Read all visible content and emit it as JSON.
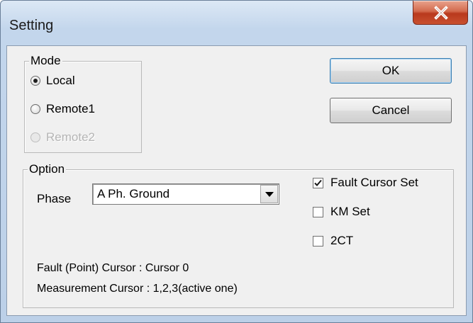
{
  "window": {
    "title": "Setting",
    "close_glyph": "X"
  },
  "mode": {
    "label": "Mode",
    "options": [
      {
        "label": "Local",
        "checked": true,
        "disabled": false
      },
      {
        "label": "Remote1",
        "checked": false,
        "disabled": false
      },
      {
        "label": "Remote2",
        "checked": false,
        "disabled": true
      }
    ]
  },
  "buttons": {
    "ok": "OK",
    "cancel": "Cancel"
  },
  "option": {
    "label": "Option",
    "phase_label": "Phase",
    "phase_value": "A Ph. Ground",
    "checkboxes": [
      {
        "label": "Fault Cursor Set",
        "checked": true
      },
      {
        "label": "KM Set",
        "checked": false
      },
      {
        "label": "2CT",
        "checked": false
      }
    ],
    "info_lines": [
      "Fault (Point) Cursor : Cursor 0",
      "Measurement Cursor : 1,2,3(active one)"
    ]
  },
  "colors": {
    "close_red": "#c8502f",
    "title_bar": "#c3d6ec",
    "dialog_face": "#f0f0f0"
  }
}
